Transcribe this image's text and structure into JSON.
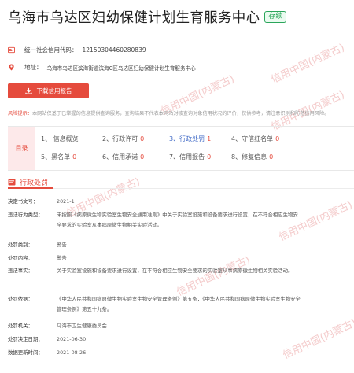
{
  "header": {
    "title": "乌海市乌达区妇幼保健计划生育服务中心",
    "status_badge": "存续"
  },
  "info": {
    "credit_code_label": "统一社会信用代码：",
    "credit_code": "12150304460280839",
    "address_label": "地址：",
    "address": "乌海市乌达区滨海街道滨海C区乌达区妇幼保健计划生育服务中心"
  },
  "download_button": "下载信用报告",
  "risk_notice": {
    "label": "风险提示：",
    "text": "本网站仅基于已掌握的信息提供查询服务，查询结果不代表本网站对被查询对象信用状况的评价，仅供参考，请注意识别和防范信用风险。"
  },
  "catalog": {
    "label": "目录",
    "items": [
      {
        "label": "1、 信息概览",
        "count": ""
      },
      {
        "label": "2、行政许可",
        "count": "0"
      },
      {
        "label": "3、行政处罚",
        "count": "1"
      },
      {
        "label": "4、守信红名单",
        "count": "0"
      },
      {
        "label": "5、黑名单",
        "count": "0"
      },
      {
        "label": "6、信用承诺",
        "count": "0"
      },
      {
        "label": "7、信用报告",
        "count": "0"
      },
      {
        "label": "8、修复信息",
        "count": "0"
      }
    ]
  },
  "section": {
    "title": "行政处罚"
  },
  "penalty": {
    "decision_no": {
      "key": "决定书文号：",
      "value": "2021-1"
    },
    "violation_type": {
      "key": "违法行为类型：",
      "value": "未按照《病原微生物实验室生物安全通用准则》中关于实验室设施和设备要求进行设置，在不符合相应生物安全要求的实验室从事病原微生物相关实验活动。"
    },
    "category": {
      "key": "处罚类别：",
      "value": "警告"
    },
    "content": {
      "key": "处罚内容：",
      "value": "警告"
    },
    "facts": {
      "key": "违法事实：",
      "value": "关于实验室设施和设备要求进行设置，在不符合相应生物安全要求的实验室从事病原微生物相关实验活动。"
    },
    "basis": {
      "key": "处罚依据：",
      "value": "《中华人民共和国病原微生物实验室生物安全管理条例》第五条，《中华人民共和国病原微生物实验室生物安全管理条例》第五十九条。"
    },
    "authority": {
      "key": "处罚机关：",
      "value": "乌海市卫生健康委员会"
    },
    "decision_date": {
      "key": "处罚决定日期：",
      "value": "2021-06-30"
    },
    "update_date": {
      "key": "数据更新时间：",
      "value": "2021-08-26"
    }
  },
  "watermark": "信用中国(内蒙古)",
  "colors": {
    "accent": "#e54b3d",
    "link": "#3b66c5",
    "badge": "#2aa55a"
  }
}
